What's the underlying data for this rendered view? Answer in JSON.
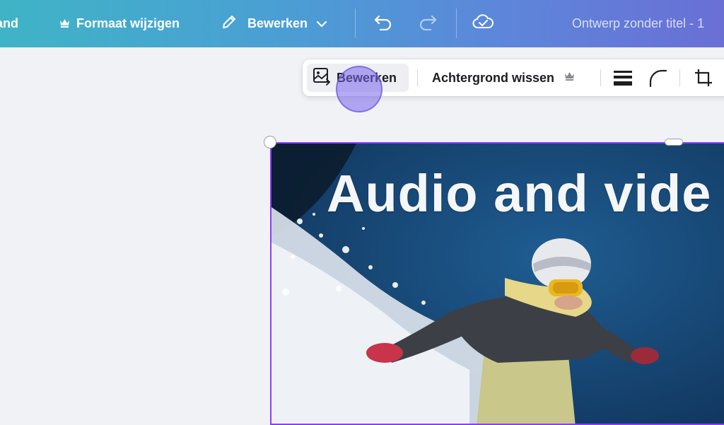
{
  "topbar": {
    "file_label": "tand",
    "resize_label": "Formaat wijzigen",
    "edit_label": "Bewerken",
    "design_title": "Ontwerp zonder titel - 1",
    "icons": [
      "crown-icon",
      "pencil-icon",
      "chevron-down-icon",
      "undo-icon",
      "redo-icon",
      "cloud-check-icon"
    ]
  },
  "context_toolbar": {
    "edit_image_label": "Bewerken",
    "remove_background_label": "Achtergrond wissen",
    "icons": [
      "edit-image-icon",
      "crown-icon",
      "border-style-icon",
      "corner-radius-icon",
      "crop-icon"
    ]
  },
  "canvas": {
    "image_caption": "Audio and vide",
    "selection_color": "#8b3dff"
  },
  "colors": {
    "topbar_gradient_start": "#3fb4c6",
    "topbar_gradient_end": "#6a6fd6",
    "canvas_background": "#f1f2f6"
  }
}
